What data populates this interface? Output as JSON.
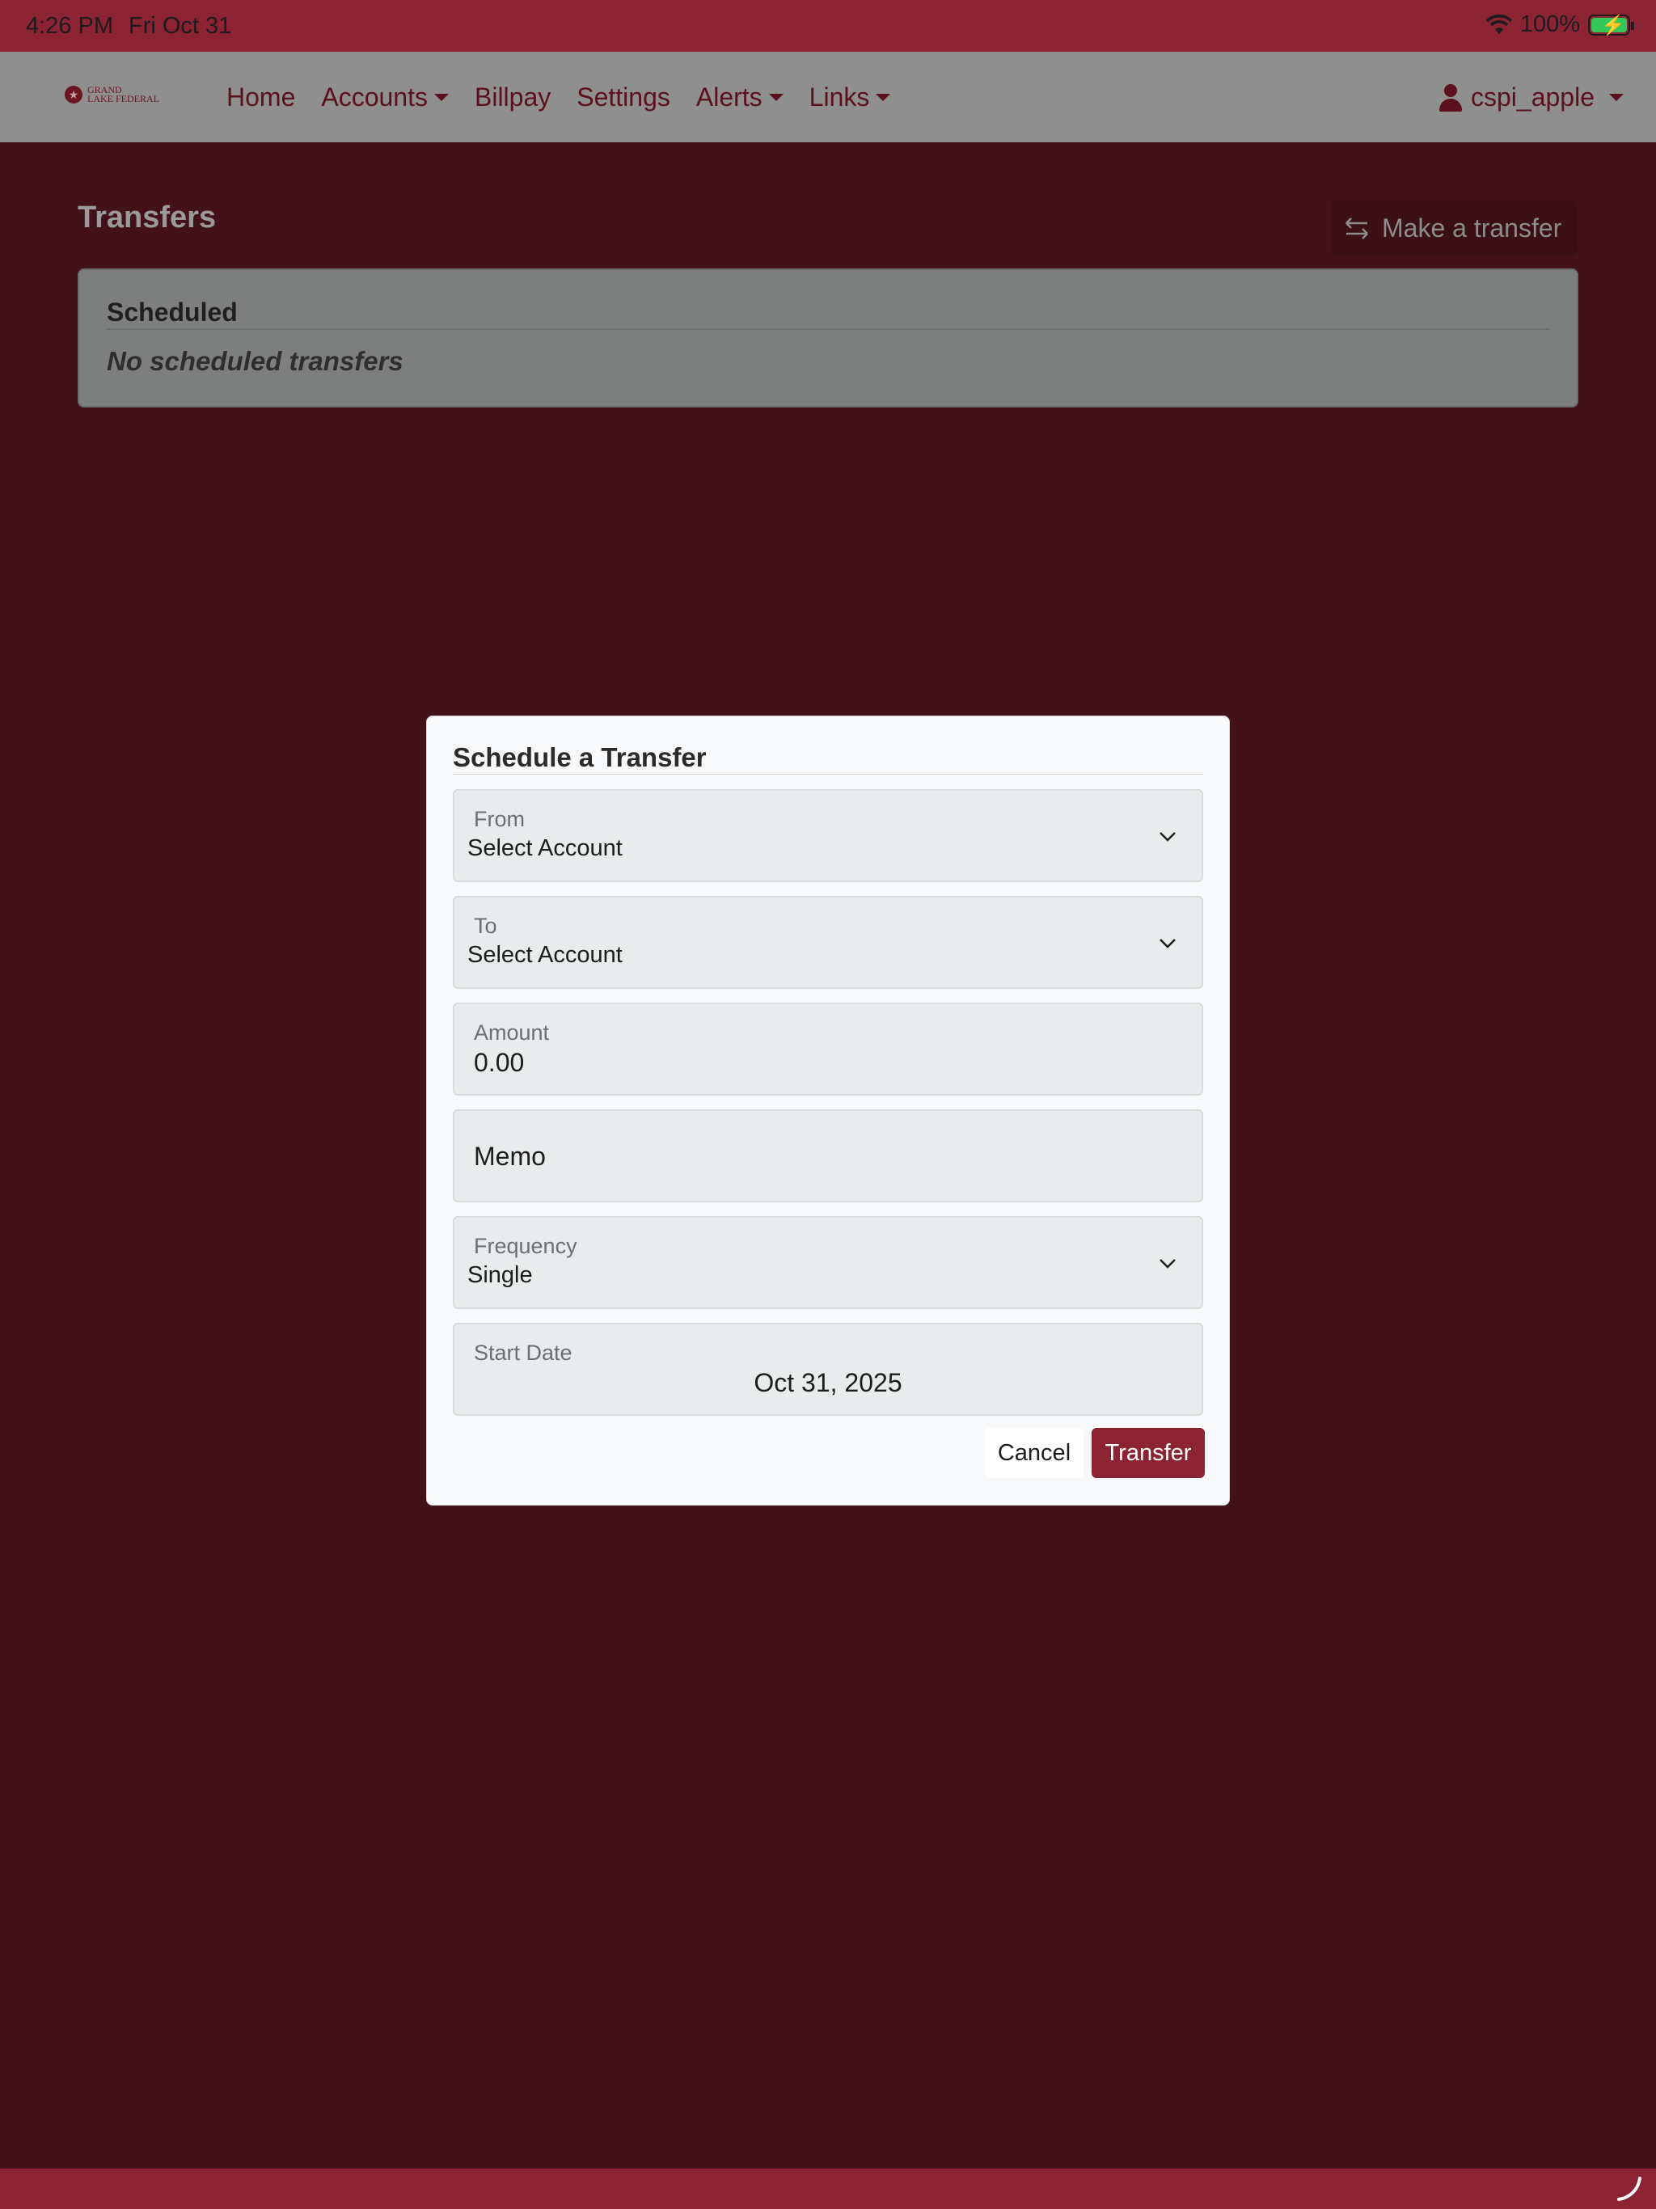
{
  "status_bar": {
    "time": "4:26 PM",
    "date": "Fri Oct 31",
    "battery": "100%",
    "icons": [
      "wifi-icon",
      "battery-charging-icon"
    ]
  },
  "navbar": {
    "logo_text": "Grand Lake Federal",
    "items": [
      {
        "label": "Home",
        "dropdown": false
      },
      {
        "label": "Accounts",
        "dropdown": true
      },
      {
        "label": "Billpay",
        "dropdown": false
      },
      {
        "label": "Settings",
        "dropdown": false
      },
      {
        "label": "Alerts",
        "dropdown": true
      },
      {
        "label": "Links",
        "dropdown": true
      }
    ],
    "user": "cspi_apple"
  },
  "page": {
    "title": "Transfers",
    "make_transfer_label": "Make a transfer",
    "scheduled": {
      "heading": "Scheduled",
      "empty_text": "No scheduled transfers"
    }
  },
  "modal": {
    "title": "Schedule a Transfer",
    "from": {
      "label": "From",
      "value": "Select Account"
    },
    "to": {
      "label": "To",
      "value": "Select Account"
    },
    "amount": {
      "label": "Amount",
      "value": "0.00"
    },
    "memo": {
      "placeholder": "Memo"
    },
    "frequency": {
      "label": "Frequency",
      "value": "Single"
    },
    "start_date": {
      "label": "Start Date",
      "value": "Oct 31, 2025"
    },
    "cancel_label": "Cancel",
    "transfer_label": "Transfer"
  },
  "colors": {
    "brand": "#8b2332",
    "overlay_bg": "#431119",
    "modal_bg": "#f8f9fa",
    "field_bg": "#e9ecec"
  }
}
